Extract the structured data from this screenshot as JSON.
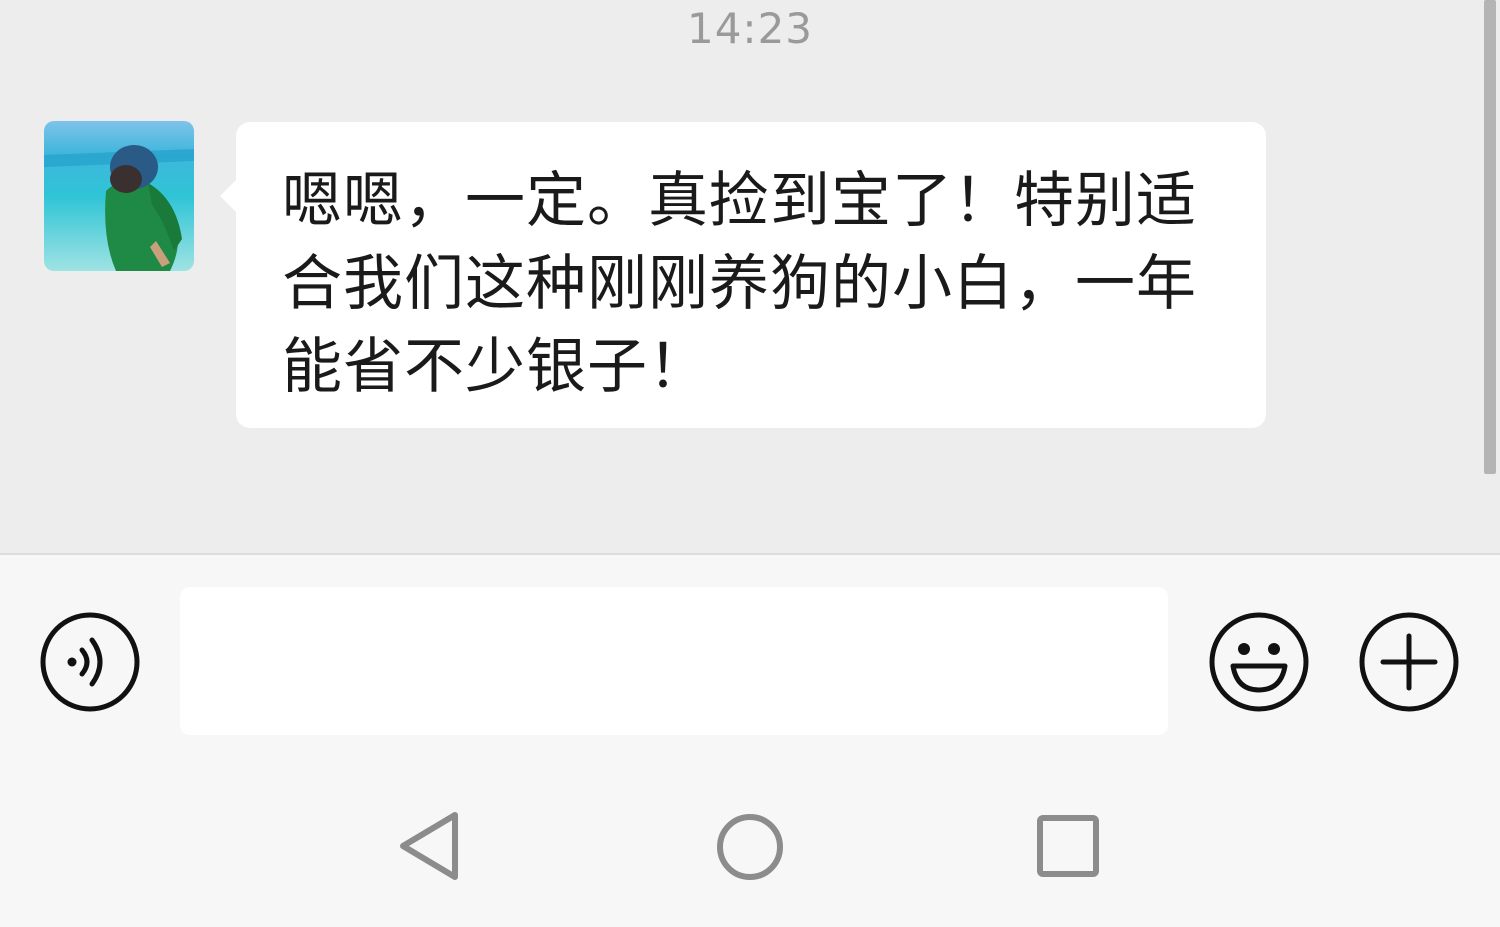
{
  "chat": {
    "timestamp": "14:23",
    "messages": [
      {
        "sender": "other",
        "avatar_icon": "avatar-person-beach",
        "text": "嗯嗯，一定。真捡到宝了！特别适合我们这种刚刚养狗的小白，一年能省不少银子！"
      }
    ]
  },
  "input_bar": {
    "value": "",
    "placeholder": "",
    "voice_icon": "voice-icon",
    "emoji_icon": "emoji-icon",
    "more_icon": "plus-icon"
  },
  "nav_bar": {
    "back_icon": "back-triangle-icon",
    "home_icon": "home-circle-icon",
    "recent_icon": "recent-square-icon"
  },
  "colors": {
    "chat_background": "#ededed",
    "bubble_background": "#ffffff",
    "input_bar_background": "#f7f7f7",
    "timestamp_text": "#9a9a9a",
    "icon_stroke": "#111111",
    "nav_icon": "#8c8c8c"
  }
}
